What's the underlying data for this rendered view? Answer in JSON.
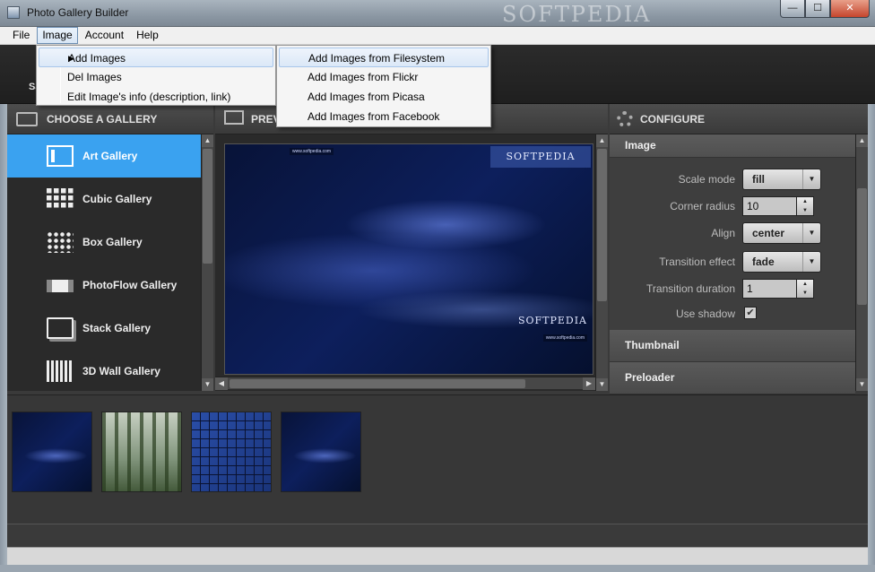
{
  "window": {
    "title": "Photo Gallery Builder",
    "watermark": "SOFTPEDIA",
    "min_glyph": "—",
    "max_glyph": "☐",
    "close_glyph": "✕"
  },
  "menubar": {
    "items": [
      "File",
      "Image",
      "Account",
      "Help"
    ],
    "active": "Image"
  },
  "toolbar": {
    "partial_label": "Sa"
  },
  "image_menu": {
    "items": [
      "Add Images",
      "Del Images",
      "Edit Image's info (description, link)"
    ],
    "submenu_arrow": "▶"
  },
  "add_images_submenu": {
    "items": [
      "Add Images from Filesystem",
      "Add Images from Flickr",
      "Add Images from Picasa",
      "Add Images from Facebook"
    ],
    "highlighted": "Add Images from Filesystem"
  },
  "sections": {
    "gallery": "CHOOSE A GALLERY",
    "preview": "PREVIEW",
    "configure": "CONFIGURE"
  },
  "galleries": {
    "items": [
      "Art Gallery",
      "Cubic Gallery",
      "Box Gallery",
      "PhotoFlow Gallery",
      "Stack Gallery",
      "3D Wall Gallery"
    ],
    "selected": "Art Gallery"
  },
  "preview": {
    "banner": "SOFTPEDIA",
    "mark": "SOFTPEDIA",
    "url": "www.softpedia.com"
  },
  "configure": {
    "sections": [
      "Image",
      "Thumbnail",
      "Preloader"
    ],
    "fields": {
      "scale_mode": {
        "label": "Scale mode",
        "value": "fill"
      },
      "corner_radius": {
        "label": "Corner radius",
        "value": "10"
      },
      "align": {
        "label": "Align",
        "value": "center"
      },
      "transition_effect": {
        "label": "Transition effect",
        "value": "fade"
      },
      "transition_duration": {
        "label": "Transition duration",
        "value": "1"
      },
      "use_shadow": {
        "label": "Use shadow",
        "checked": true,
        "check_glyph": "✔"
      }
    }
  },
  "thumbnails": {
    "count": 4
  },
  "icons": {
    "arrow_up": "▲",
    "arrow_down": "▼",
    "arrow_left": "◀",
    "arrow_right": "▶"
  }
}
